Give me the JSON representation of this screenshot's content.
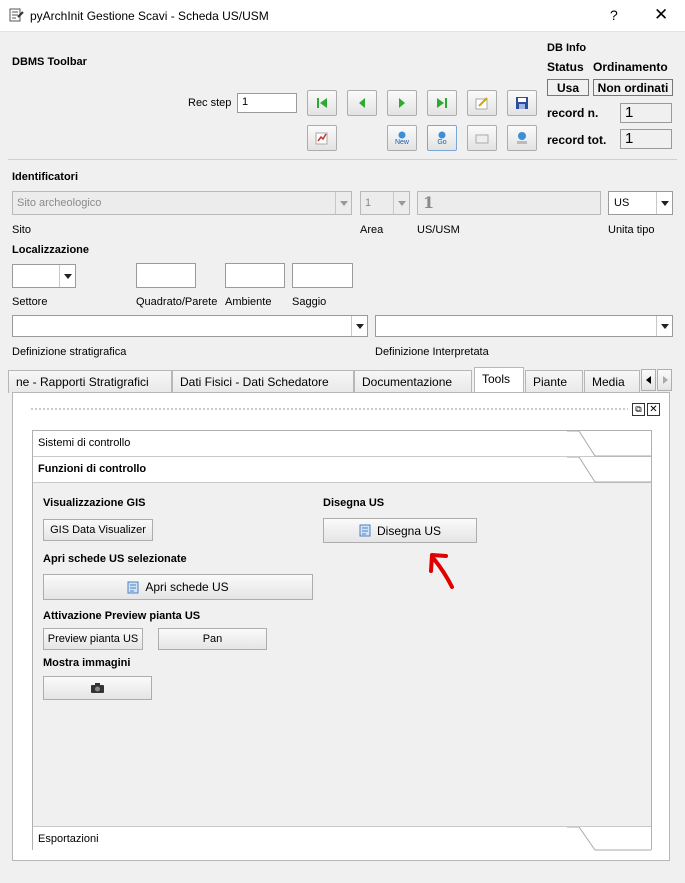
{
  "window": {
    "title": "pyArchInit Gestione Scavi - Scheda US/USM",
    "help": "?",
    "close": "✕"
  },
  "dbms": {
    "title": "DBMS Toolbar",
    "rec_step_label": "Rec step",
    "rec_step_value": "1",
    "db_info": "DB Info",
    "status_label": "Status",
    "ordinamento_label": "Ordinamento",
    "status_value": "Usa",
    "ordinamento_value": "Non ordinati",
    "record_n_label": "record n.",
    "record_n_value": "1",
    "record_tot_label": "record tot.",
    "record_tot_value": "1",
    "new_label": "New",
    "go_label": "Go"
  },
  "identificatori": {
    "title": "Identificatori",
    "sito_placeholder": "Sito archeologico",
    "sito_label": "Sito",
    "area_value": "1",
    "area_label": "Area",
    "us_value": "1",
    "us_label": "US/USM",
    "unita_value": "US",
    "unita_label": "Unita tipo"
  },
  "localizzazione": {
    "title": "Localizzazione",
    "settore_label": "Settore",
    "quadrato_label": "Quadrato/Parete",
    "ambiente_label": "Ambiente",
    "saggio_label": "Saggio",
    "def_strat_label": "Definizione stratigrafica",
    "def_interp_label": "Definizione Interpretata"
  },
  "tabs": [
    {
      "label": "ne - Rapporti Stratigrafici"
    },
    {
      "label": "Dati Fisici - Dati Schedatore"
    },
    {
      "label": "Documentazione"
    },
    {
      "label": "Tools"
    },
    {
      "label": "Piante"
    },
    {
      "label": "Media"
    }
  ],
  "tools": {
    "sistemi": "Sistemi di controllo",
    "funzioni": "Funzioni di controllo",
    "gis_title": "Visualizzazione GIS",
    "gis_button": "GIS Data Visualizer",
    "disegna_title": "Disegna US",
    "disegna_button": "Disegna US",
    "apri_title": "Apri schede US selezionate",
    "apri_button": "Apri schede US",
    "preview_title": "Attivazione Preview pianta US",
    "preview_button": "Preview pianta US",
    "pan_button": "Pan",
    "mostra_title": "Mostra immagini",
    "esportazioni": "Esportazioni"
  },
  "colors": {
    "green_nav": "#2eaa2e",
    "accent_red": "#e00000"
  }
}
